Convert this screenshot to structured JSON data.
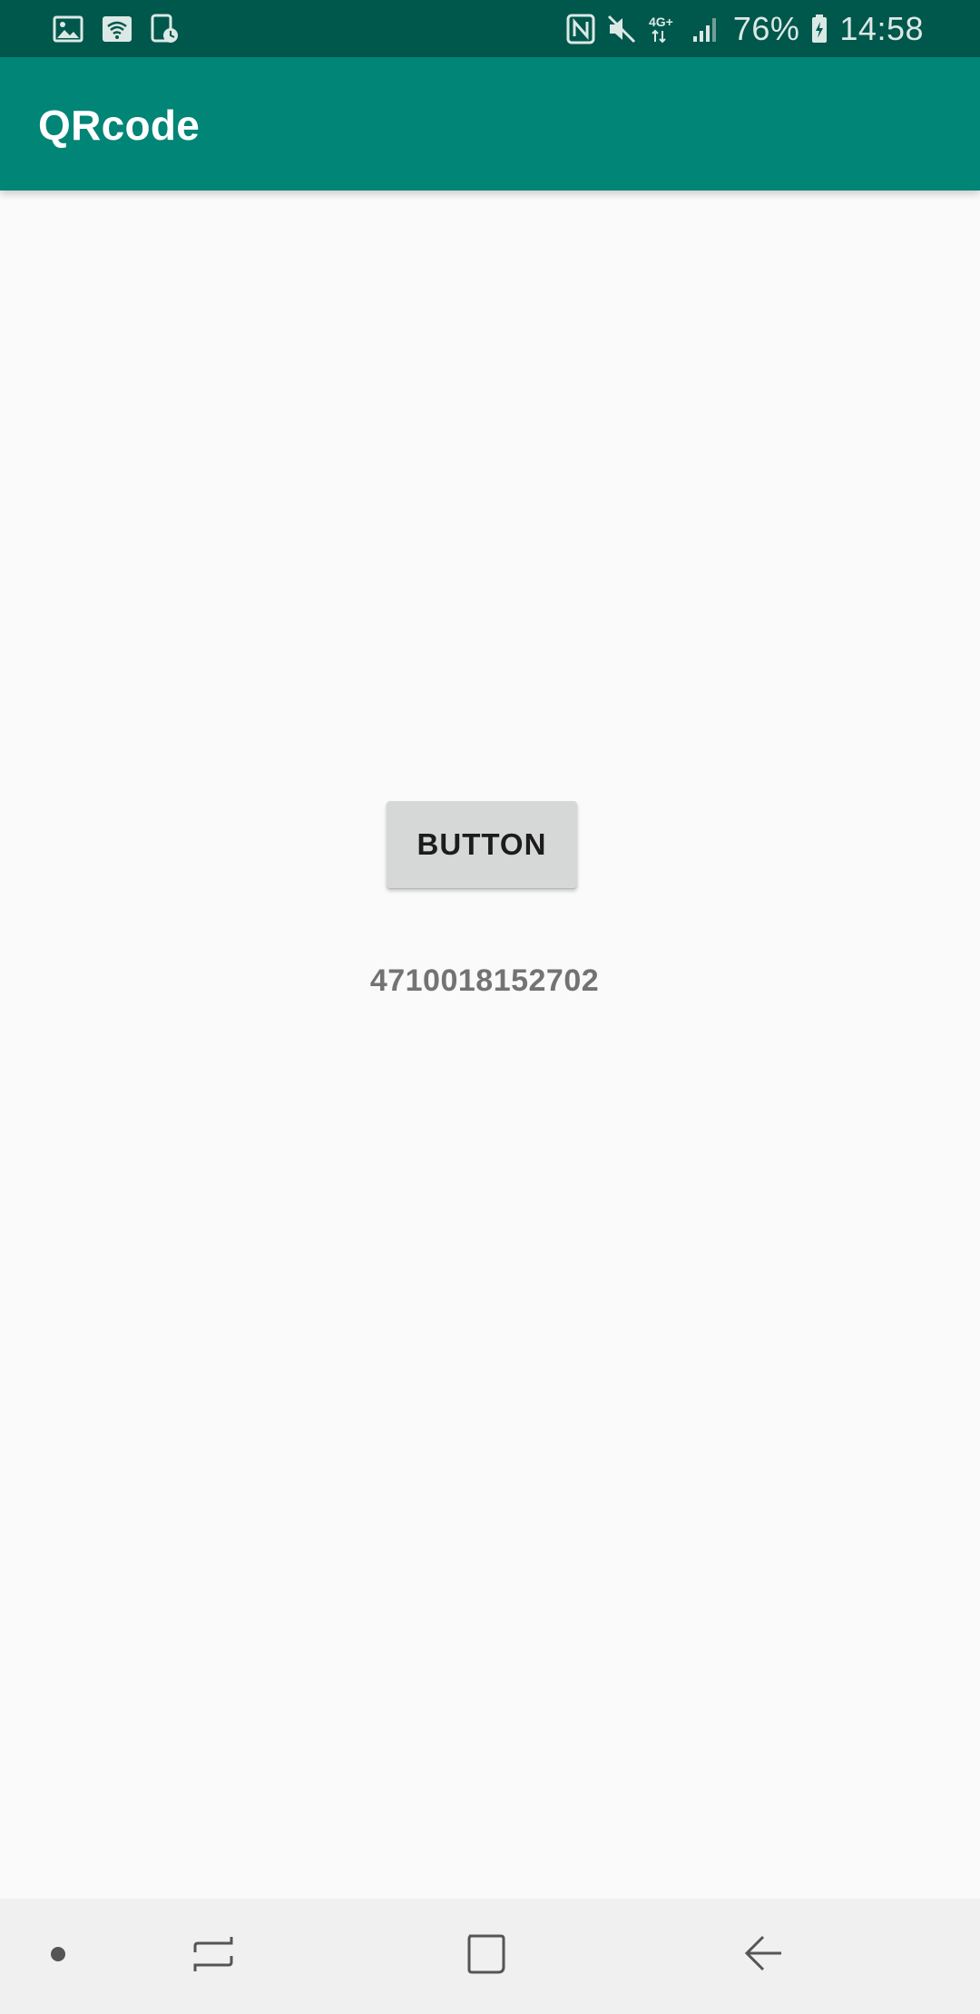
{
  "status_bar": {
    "time": "14:58",
    "battery_percent": "76%",
    "network_type": "4G+",
    "icons_left": [
      "image-icon",
      "wifi-icon",
      "device-timer-icon"
    ],
    "icons_right": [
      "nfc-icon",
      "mute-icon",
      "network-4g-icon",
      "signal-icon",
      "battery-icon"
    ],
    "bg_color": "#00574b"
  },
  "app_bar": {
    "title": "QRcode",
    "bg_color": "#008577"
  },
  "main": {
    "button_label": "BUTTON",
    "result_text": "4710018152702"
  },
  "nav_bar": {
    "items": [
      "dot-icon",
      "recent-apps-icon",
      "home-icon",
      "back-icon"
    ]
  }
}
